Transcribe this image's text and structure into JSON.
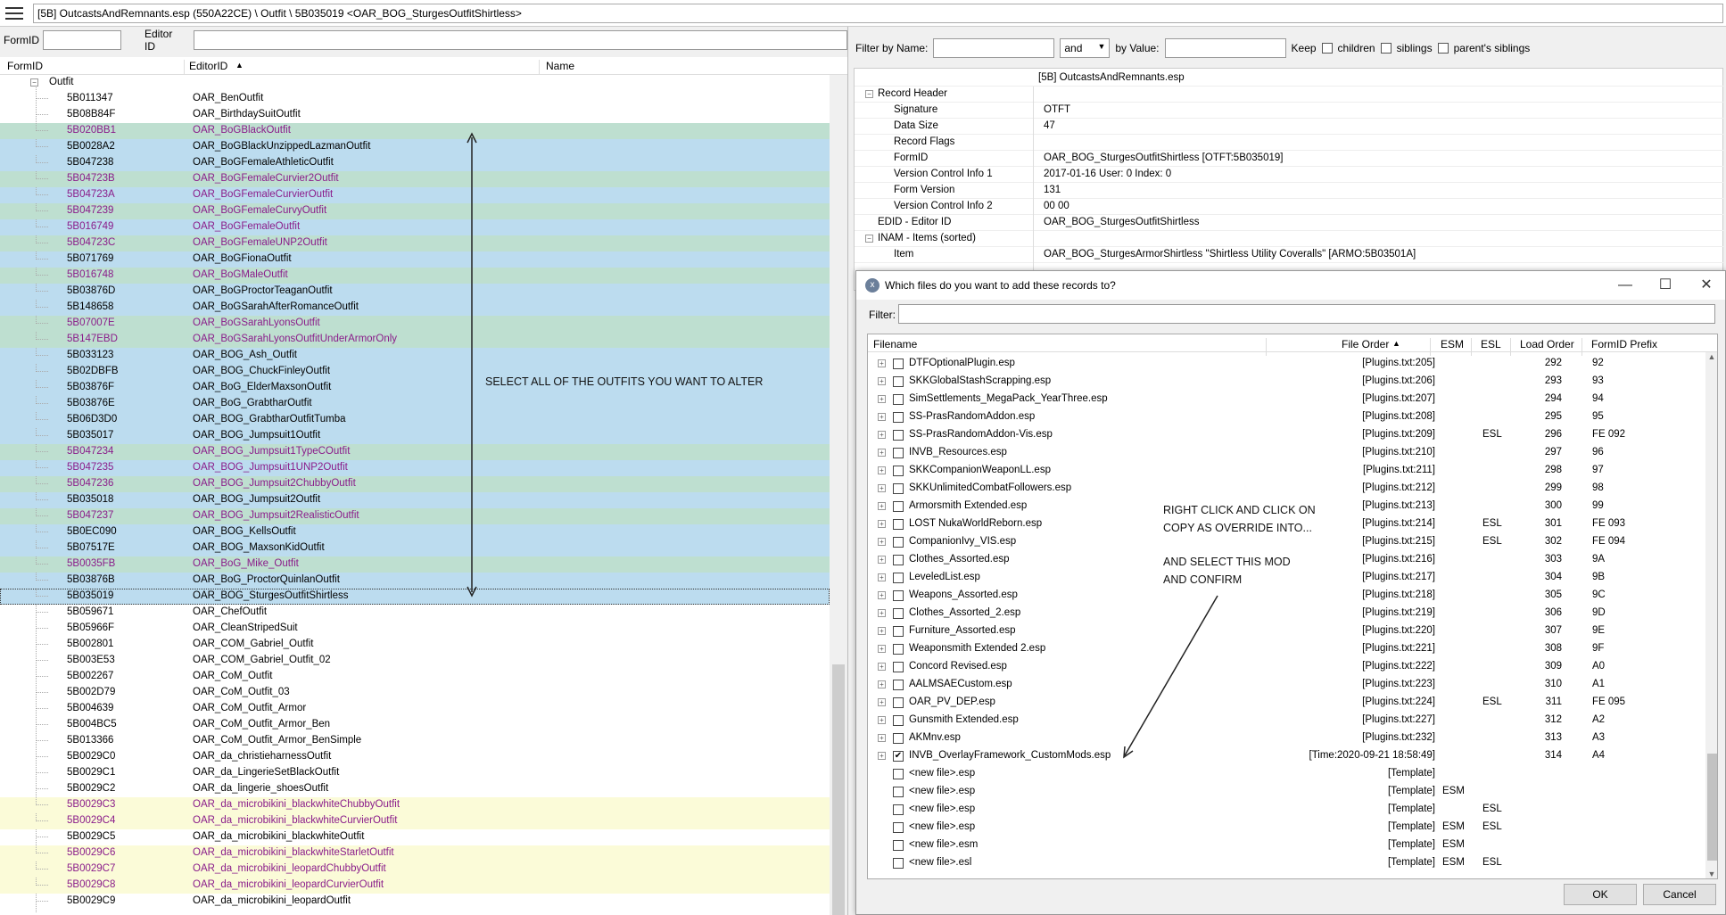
{
  "titlebar": {
    "path": "[5B] OutcastsAndRemnants.esp (550A22CE) \\ Outfit \\ 5B035019 <OAR_BOG_SturgesOutfitShirtless>"
  },
  "left": {
    "formid_label": "FormID",
    "editorid_label": "Editor ID",
    "columns": {
      "formid": "FormID",
      "editorid": "EditorID",
      "name": "Name"
    },
    "group": "Outfit",
    "rows": [
      {
        "fid": "5B011347",
        "eid": "OAR_BenOutfit",
        "s": ""
      },
      {
        "fid": "5B08B84F",
        "eid": "OAR_BirthdaySuitOutfit",
        "s": ""
      },
      {
        "fid": "5B020BB1",
        "eid": "OAR_BoGBlackOutfit",
        "s": "alt purple"
      },
      {
        "fid": "5B0028A2",
        "eid": "OAR_BoGBlackUnzippedLazmanOutfit",
        "s": "sel"
      },
      {
        "fid": "5B047238",
        "eid": "OAR_BoGFemaleAthleticOutfit",
        "s": "sel"
      },
      {
        "fid": "5B04723B",
        "eid": "OAR_BoGFemaleCurvier2Outfit",
        "s": "alt purple"
      },
      {
        "fid": "5B04723A",
        "eid": "OAR_BoGFemaleCurvierOutfit",
        "s": "sel purple"
      },
      {
        "fid": "5B047239",
        "eid": "OAR_BoGFemaleCurvyOutfit",
        "s": "alt purple"
      },
      {
        "fid": "5B016749",
        "eid": "OAR_BoGFemaleOutfit",
        "s": "sel purple"
      },
      {
        "fid": "5B04723C",
        "eid": "OAR_BoGFemaleUNP2Outfit",
        "s": "alt purple"
      },
      {
        "fid": "5B071769",
        "eid": "OAR_BoGFionaOutfit",
        "s": "sel"
      },
      {
        "fid": "5B016748",
        "eid": "OAR_BoGMaleOutfit",
        "s": "alt purple"
      },
      {
        "fid": "5B03876D",
        "eid": "OAR_BoGProctorTeaganOutfit",
        "s": "sel"
      },
      {
        "fid": "5B148658",
        "eid": "OAR_BoGSarahAfterRomanceOutfit",
        "s": "sel"
      },
      {
        "fid": "5B07007E",
        "eid": "OAR_BoGSarahLyonsOutfit",
        "s": "alt purple"
      },
      {
        "fid": "5B147EBD",
        "eid": "OAR_BoGSarahLyonsOutfitUnderArmorOnly",
        "s": "alt purple"
      },
      {
        "fid": "5B033123",
        "eid": "OAR_BOG_Ash_Outfit",
        "s": "sel"
      },
      {
        "fid": "5B02DBFB",
        "eid": "OAR_BOG_ChuckFinleyOutfit",
        "s": "sel"
      },
      {
        "fid": "5B03876F",
        "eid": "OAR_BoG_ElderMaxsonOutfit",
        "s": "sel"
      },
      {
        "fid": "5B03876E",
        "eid": "OAR_BoG_GrabtharOutfit",
        "s": "sel"
      },
      {
        "fid": "5B06D3D0",
        "eid": "OAR_BOG_GrabtharOutfitTumba",
        "s": "sel"
      },
      {
        "fid": "5B035017",
        "eid": "OAR_BOG_Jumpsuit1Outfit",
        "s": "sel"
      },
      {
        "fid": "5B047234",
        "eid": "OAR_BOG_Jumpsuit1TypeCOutfit",
        "s": "alt purple"
      },
      {
        "fid": "5B047235",
        "eid": "OAR_BOG_Jumpsuit1UNP2Outfit",
        "s": "sel purple"
      },
      {
        "fid": "5B047236",
        "eid": "OAR_BOG_Jumpsuit2ChubbyOutfit",
        "s": "alt purple"
      },
      {
        "fid": "5B035018",
        "eid": "OAR_BOG_Jumpsuit2Outfit",
        "s": "sel"
      },
      {
        "fid": "5B047237",
        "eid": "OAR_BOG_Jumpsuit2RealisticOutfit",
        "s": "alt purple"
      },
      {
        "fid": "5B0EC090",
        "eid": "OAR_BOG_KellsOutfit",
        "s": "sel"
      },
      {
        "fid": "5B07517E",
        "eid": "OAR_BOG_MaxsonKidOutfit",
        "s": "sel"
      },
      {
        "fid": "5B0035FB",
        "eid": "OAR_BoG_Mike_Outfit",
        "s": "alt purple"
      },
      {
        "fid": "5B03876B",
        "eid": "OAR_BoG_ProctorQuinlanOutfit",
        "s": "sel"
      },
      {
        "fid": "5B035019",
        "eid": "OAR_BOG_SturgesOutfitShirtless",
        "s": "sel focus"
      },
      {
        "fid": "5B059671",
        "eid": "OAR_ChefOutfit",
        "s": ""
      },
      {
        "fid": "5B05966F",
        "eid": "OAR_CleanStripedSuit",
        "s": ""
      },
      {
        "fid": "5B002801",
        "eid": "OAR_COM_Gabriel_Outfit",
        "s": ""
      },
      {
        "fid": "5B003E53",
        "eid": "OAR_COM_Gabriel_Outfit_02",
        "s": ""
      },
      {
        "fid": "5B002267",
        "eid": "OAR_CoM_Outfit",
        "s": ""
      },
      {
        "fid": "5B002D79",
        "eid": "OAR_CoM_Outfit_03",
        "s": ""
      },
      {
        "fid": "5B004639",
        "eid": "OAR_CoM_Outfit_Armor",
        "s": ""
      },
      {
        "fid": "5B004BC5",
        "eid": "OAR_CoM_Outfit_Armor_Ben",
        "s": ""
      },
      {
        "fid": "5B013366",
        "eid": "OAR_CoM_Outfit_Armor_BenSimple",
        "s": ""
      },
      {
        "fid": "5B0029C0",
        "eid": "OAR_da_christieharnessOutfit",
        "s": ""
      },
      {
        "fid": "5B0029C1",
        "eid": "OAR_da_LingerieSetBlackOutfit",
        "s": ""
      },
      {
        "fid": "5B0029C2",
        "eid": "OAR_da_lingerie_shoesOutfit",
        "s": ""
      },
      {
        "fid": "5B0029C3",
        "eid": "OAR_da_microbikini_blackwhiteChubbyOutfit",
        "s": "yel purple"
      },
      {
        "fid": "5B0029C4",
        "eid": "OAR_da_microbikini_blackwhiteCurvierOutfit",
        "s": "yel purple"
      },
      {
        "fid": "5B0029C5",
        "eid": "OAR_da_microbikini_blackwhiteOutfit",
        "s": ""
      },
      {
        "fid": "5B0029C6",
        "eid": "OAR_da_microbikini_blackwhiteStarletOutfit",
        "s": "yel purple"
      },
      {
        "fid": "5B0029C7",
        "eid": "OAR_da_microbikini_leopardChubbyOutfit",
        "s": "yel purple"
      },
      {
        "fid": "5B0029C8",
        "eid": "OAR_da_microbikini_leopardCurvierOutfit",
        "s": "yel purple"
      },
      {
        "fid": "5B0029C9",
        "eid": "OAR_da_microbikini_leopardOutfit",
        "s": ""
      }
    ],
    "annotation": "SELECT ALL OF THE OUTFITS YOU WANT TO ALTER"
  },
  "filterbar": {
    "by_name": "Filter by Name:",
    "op": "and",
    "by_value": "by Value:",
    "keep": "Keep",
    "children": "children",
    "siblings": "siblings",
    "parents_siblings": "parent's siblings"
  },
  "record": {
    "file": "[5B] OutcastsAndRemnants.esp",
    "rows": [
      {
        "k": "Record Header",
        "v": "",
        "lvl": 0,
        "exp": "minus"
      },
      {
        "k": "Signature",
        "v": "OTFT",
        "lvl": 1
      },
      {
        "k": "Data Size",
        "v": "47",
        "lvl": 1
      },
      {
        "k": "Record Flags",
        "v": "",
        "lvl": 1
      },
      {
        "k": "FormID",
        "v": "OAR_BOG_SturgesOutfitShirtless [OTFT:5B035019]",
        "lvl": 1
      },
      {
        "k": "Version Control Info 1",
        "v": "2017-01-16 User: 0 Index: 0",
        "lvl": 1
      },
      {
        "k": "Form Version",
        "v": "131",
        "lvl": 1
      },
      {
        "k": "Version Control Info 2",
        "v": "00 00",
        "lvl": 1
      },
      {
        "k": "EDID - Editor ID",
        "v": "OAR_BOG_SturgesOutfitShirtless",
        "lvl": 0
      },
      {
        "k": "INAM - Items (sorted)",
        "v": "",
        "lvl": 0,
        "exp": "minus"
      },
      {
        "k": "Item",
        "v": "OAR_BOG_SturgesArmorShirtless \"Shirtless Utility Coveralls\" [ARMO:5B03501A]",
        "lvl": 1
      }
    ]
  },
  "dialog": {
    "title": "Which files do you want to add these records to?",
    "filter_label": "Filter:",
    "columns": {
      "filename": "Filename",
      "order": "File Order",
      "esm": "ESM",
      "esl": "ESL",
      "load": "Load Order",
      "prefix": "FormID Prefix"
    },
    "rows": [
      {
        "n": "DTFOptionalPlugin.esp",
        "o": "[Plugins.txt:205]",
        "esm": "",
        "esl": "",
        "lo": "292",
        "p": "92",
        "plus": true
      },
      {
        "n": "SKKGlobalStashScrapping.esp",
        "o": "[Plugins.txt:206]",
        "esm": "",
        "esl": "",
        "lo": "293",
        "p": "93",
        "plus": true
      },
      {
        "n": "SimSettlements_MegaPack_YearThree.esp",
        "o": "[Plugins.txt:207]",
        "esm": "",
        "esl": "",
        "lo": "294",
        "p": "94",
        "plus": true
      },
      {
        "n": "SS-PrasRandomAddon.esp",
        "o": "[Plugins.txt:208]",
        "esm": "",
        "esl": "",
        "lo": "295",
        "p": "95",
        "plus": true
      },
      {
        "n": "SS-PrasRandomAddon-Vis.esp",
        "o": "[Plugins.txt:209]",
        "esm": "",
        "esl": "ESL",
        "lo": "296",
        "p": "FE 092",
        "plus": true
      },
      {
        "n": "INVB_Resources.esp",
        "o": "[Plugins.txt:210]",
        "esm": "",
        "esl": "",
        "lo": "297",
        "p": "96",
        "plus": true
      },
      {
        "n": "SKKCompanionWeaponLL.esp",
        "o": "[Plugins.txt:211]",
        "esm": "",
        "esl": "",
        "lo": "298",
        "p": "97",
        "plus": true
      },
      {
        "n": "SKKUnlimitedCombatFollowers.esp",
        "o": "[Plugins.txt:212]",
        "esm": "",
        "esl": "",
        "lo": "299",
        "p": "98",
        "plus": true
      },
      {
        "n": "Armorsmith Extended.esp",
        "o": "[Plugins.txt:213]",
        "esm": "",
        "esl": "",
        "lo": "300",
        "p": "99",
        "plus": true
      },
      {
        "n": "LOST NukaWorldReborn.esp",
        "o": "[Plugins.txt:214]",
        "esm": "",
        "esl": "ESL",
        "lo": "301",
        "p": "FE 093",
        "plus": true
      },
      {
        "n": "CompanionIvy_VIS.esp",
        "o": "[Plugins.txt:215]",
        "esm": "",
        "esl": "ESL",
        "lo": "302",
        "p": "FE 094",
        "plus": true
      },
      {
        "n": "Clothes_Assorted.esp",
        "o": "[Plugins.txt:216]",
        "esm": "",
        "esl": "",
        "lo": "303",
        "p": "9A",
        "plus": true
      },
      {
        "n": "LeveledList.esp",
        "o": "[Plugins.txt:217]",
        "esm": "",
        "esl": "",
        "lo": "304",
        "p": "9B",
        "plus": true
      },
      {
        "n": "Weapons_Assorted.esp",
        "o": "[Plugins.txt:218]",
        "esm": "",
        "esl": "",
        "lo": "305",
        "p": "9C",
        "plus": true
      },
      {
        "n": "Clothes_Assorted_2.esp",
        "o": "[Plugins.txt:219]",
        "esm": "",
        "esl": "",
        "lo": "306",
        "p": "9D",
        "plus": true
      },
      {
        "n": "Furniture_Assorted.esp",
        "o": "[Plugins.txt:220]",
        "esm": "",
        "esl": "",
        "lo": "307",
        "p": "9E",
        "plus": true
      },
      {
        "n": "Weaponsmith Extended 2.esp",
        "o": "[Plugins.txt:221]",
        "esm": "",
        "esl": "",
        "lo": "308",
        "p": "9F",
        "plus": true
      },
      {
        "n": "Concord Revised.esp",
        "o": "[Plugins.txt:222]",
        "esm": "",
        "esl": "",
        "lo": "309",
        "p": "A0",
        "plus": true
      },
      {
        "n": "AALMSAECustom.esp",
        "o": "[Plugins.txt:223]",
        "esm": "",
        "esl": "",
        "lo": "310",
        "p": "A1",
        "plus": true
      },
      {
        "n": "OAR_PV_DEP.esp",
        "o": "[Plugins.txt:224]",
        "esm": "",
        "esl": "ESL",
        "lo": "311",
        "p": "FE 095",
        "plus": true
      },
      {
        "n": "Gunsmith Extended.esp",
        "o": "[Plugins.txt:227]",
        "esm": "",
        "esl": "",
        "lo": "312",
        "p": "A2",
        "plus": true
      },
      {
        "n": "AKMnv.esp",
        "o": "[Plugins.txt:232]",
        "esm": "",
        "esl": "",
        "lo": "313",
        "p": "A3",
        "plus": true
      },
      {
        "n": "INVB_OverlayFramework_CustomMods.esp",
        "o": "[Time:2020-09-21 18:58:49]",
        "esm": "",
        "esl": "",
        "lo": "314",
        "p": "A4",
        "plus": true,
        "checked": true
      },
      {
        "n": "<new file>.esp",
        "o": "[Template]",
        "esm": "",
        "esl": "",
        "lo": "",
        "p": "",
        "plus": false
      },
      {
        "n": "<new file>.esp",
        "o": "[Template]",
        "esm": "ESM",
        "esl": "",
        "lo": "",
        "p": "",
        "plus": false
      },
      {
        "n": "<new file>.esp",
        "o": "[Template]",
        "esm": "",
        "esl": "ESL",
        "lo": "",
        "p": "",
        "plus": false
      },
      {
        "n": "<new file>.esp",
        "o": "[Template]",
        "esm": "ESM",
        "esl": "ESL",
        "lo": "",
        "p": "",
        "plus": false
      },
      {
        "n": "<new file>.esm",
        "o": "[Template]",
        "esm": "ESM",
        "esl": "",
        "lo": "",
        "p": "",
        "plus": false
      },
      {
        "n": "<new file>.esl",
        "o": "[Template]",
        "esm": "ESM",
        "esl": "ESL",
        "lo": "",
        "p": "",
        "plus": false
      }
    ],
    "ok": "OK",
    "cancel": "Cancel",
    "annotation_line1": "RIGHT CLICK AND CLICK ON",
    "annotation_line2": "COPY AS OVERRIDE INTO...",
    "annotation_line3": "AND SELECT THIS MOD",
    "annotation_line4": "AND CONFIRM"
  },
  "colors": {
    "selected_row": "#bcdcef",
    "alt_row": "#bedfd0",
    "yellow_row": "#fbfbd8",
    "purple_text": "#8a1c8a"
  }
}
